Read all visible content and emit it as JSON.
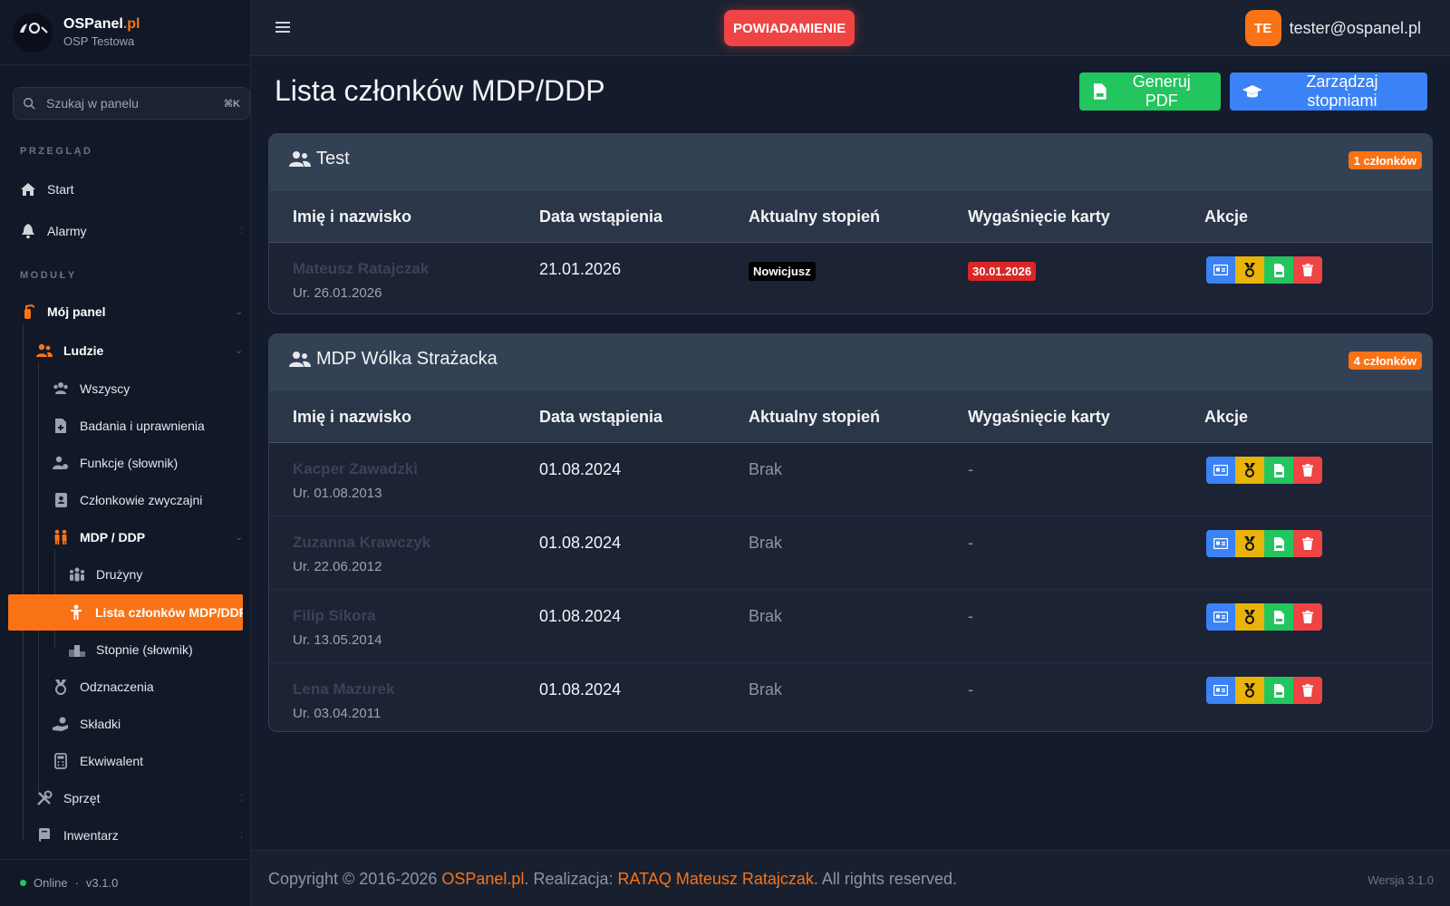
{
  "brand": {
    "name_main": "OSPanel",
    "name_accent": ".pl",
    "subtitle": "OSP Testowa"
  },
  "search": {
    "placeholder": "Szukaj w panelu",
    "shortcut": "⌘K"
  },
  "sidebar": {
    "section_overview": "PRZEGLĄD",
    "section_modules": "MODUŁY",
    "items": {
      "start": "Start",
      "alarmy": "Alarmy",
      "moj_panel": "Mój panel",
      "ludzie": "Ludzie",
      "wszyscy": "Wszyscy",
      "badania": "Badania i uprawnienia",
      "funkcje": "Funkcje (słownik)",
      "czlonkowie": "Członkowie zwyczajni",
      "mdp": "MDP / DDP",
      "druzyny": "Drużyny",
      "lista": "Lista członków MDP/DDP",
      "stopnie": "Stopnie (słownik)",
      "odznaczenia": "Odznaczenia",
      "skladki": "Składki",
      "ekwiwalent": "Ekwiwalent",
      "sprzet": "Sprzęt",
      "inwentarz": "Inwentarz"
    },
    "footer": {
      "status": "Online",
      "version": "v3.1.0"
    }
  },
  "topbar": {
    "notification": "POWIADAMIENIE",
    "avatar_initials": "TE",
    "email": "tester@ospanel.pl"
  },
  "main": {
    "title": "Lista członków MDP/DDP",
    "btn_pdf": "Generuj PDF",
    "btn_manage": "Zarządzaj stopniami"
  },
  "table_headers": {
    "name": "Imię i nazwisko",
    "joined": "Data wstąpienia",
    "rank": "Aktualny stopień",
    "expiry": "Wygaśnięcie karty",
    "actions": "Akcje"
  },
  "groups": [
    {
      "title": "Test",
      "count": "1 członków",
      "members": [
        {
          "name": "Mateusz Ratajczak",
          "dob": "Ur. 26.01.2026",
          "joined": "21.01.2026",
          "rank": "Nowicjusz",
          "expiry": "30.01.2026"
        }
      ]
    },
    {
      "title": "MDP Wólka Strażacka",
      "count": "4 członków",
      "members": [
        {
          "name": "Kacper Zawadzki",
          "dob": "Ur. 01.08.2013",
          "joined": "01.08.2024",
          "rank": "Brak",
          "expiry": "-"
        },
        {
          "name": "Zuzanna Krawczyk",
          "dob": "Ur. 22.06.2012",
          "joined": "01.08.2024",
          "rank": "Brak",
          "expiry": "-"
        },
        {
          "name": "Filip Sikora",
          "dob": "Ur. 13.05.2014",
          "joined": "01.08.2024",
          "rank": "Brak",
          "expiry": "-"
        },
        {
          "name": "Lena Mazurek",
          "dob": "Ur. 03.04.2011",
          "joined": "01.08.2024",
          "rank": "Brak",
          "expiry": "-"
        }
      ]
    }
  ],
  "footer": {
    "copyright_prefix": "Copyright © 2016-2026 ",
    "brand": "OSPanel.pl",
    "mid": ". Realizacja: ",
    "author": "RATAQ Mateusz Ratajczak",
    "suffix": ". All rights reserved.",
    "version": "Wersja 3.1.0"
  },
  "colors": {
    "accent": "#f97316",
    "primary": "#3b82f6",
    "success": "#22c55e",
    "danger": "#ef4444",
    "warning": "#eab308"
  }
}
